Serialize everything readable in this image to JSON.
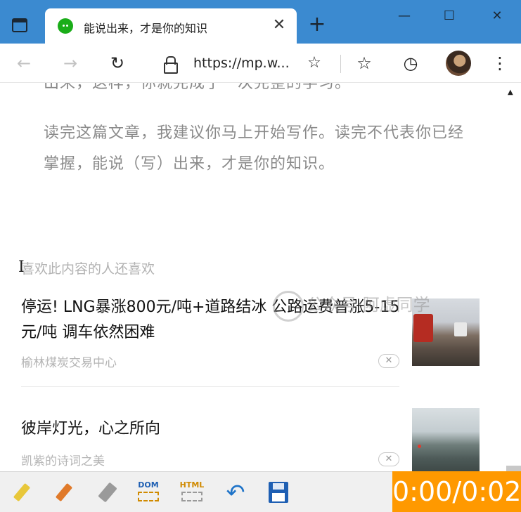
{
  "browser": {
    "tab_title": "能说出来，才是你的知识",
    "tab_close": "✕",
    "new_tab": "+",
    "window": {
      "minimize": "—",
      "maximize": "☐",
      "close": "✕"
    },
    "url": "https://mp.w...",
    "icons": {
      "back": "back-arrow-icon",
      "forward": "forward-arrow-icon",
      "reload": "reload-icon",
      "lock": "lock-icon",
      "favorite_add": "add-favorite-icon",
      "favorites": "favorites-icon",
      "history": "history-icon",
      "menu": "more-menu-icon"
    }
  },
  "article": {
    "cut_line": "出来，这样，你就完成了一次完整的学习。",
    "paragraph": "读完这篇文章，我建议你马上开始写作。读完不代表你已经掌握，能说（写）出来，才是你的知识。"
  },
  "recommendations": {
    "section_title": "喜欢此内容的人还喜欢",
    "items": [
      {
        "title": "停运! LNG暴涨800元/吨+道路结冰 公路运费普涨5-15元/吨 调车依然困难",
        "source": "榆林煤炭交易中心",
        "dismiss": "✕"
      },
      {
        "title": "彼岸灯光，心之所向",
        "source": "凯紫的诗词之美",
        "dismiss": "✕"
      }
    ]
  },
  "watermark": "公众号·阿虚同学",
  "annotation_toolbar": {
    "dom_label": "DOM",
    "html_label": "HTML",
    "timer": "0:00/0:02",
    "colors": {
      "highlighter": "#e8c73a",
      "pen": "#e07a2a",
      "eraser": "#9a9a9a",
      "accent": "#ff9900",
      "blue": "#1e73c8"
    }
  }
}
